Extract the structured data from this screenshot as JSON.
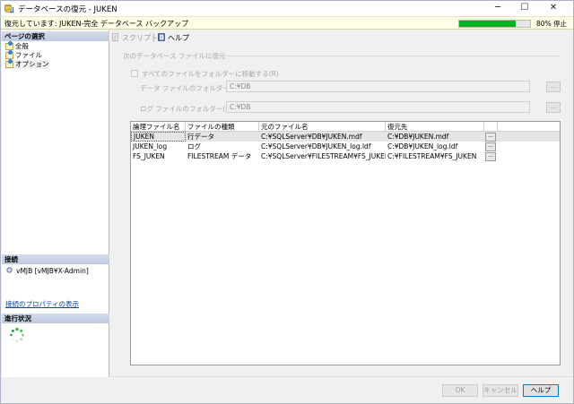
{
  "window": {
    "title": "データベースの復元 - JUKEN",
    "controls": {
      "minimize": "─",
      "maximize": "☐",
      "close": "✕"
    }
  },
  "status": {
    "text": "復元しています: JUKEN-完全 データベース バックアップ",
    "progress_percent": 80,
    "progress_label": "80% 停止",
    "progress_color": "#06b025"
  },
  "sidebar": {
    "page_select_header": "ページの選択",
    "pages": [
      {
        "label": "全般"
      },
      {
        "label": "ファイル"
      },
      {
        "label": "オプション"
      }
    ],
    "connection_header": "接続",
    "connection_user": "vMJB [vMJB¥X-Admin]",
    "connection_link": "接続のプロパティの表示",
    "progress_header": "進行状況"
  },
  "toolbar": {
    "script_label": "スクリプト",
    "script_arrow": "▾",
    "help_label": "ヘルプ"
  },
  "restore_to": {
    "group_title": "次のデータベース ファイルに復元",
    "move_all_label": "すべてのファイルをフォルダーに移動する(R)",
    "data_folder_label": "データ ファイルのフォルダー(D):",
    "data_folder_value": "C:¥DB",
    "log_folder_label": "ログ ファイルのフォルダー(L):",
    "log_folder_value": "C:¥DB",
    "browse_label": "..."
  },
  "file_grid": {
    "columns": [
      "論理ファイル名",
      "ファイルの種類",
      "元のファイル名",
      "復元先"
    ],
    "rows": [
      {
        "logical": "JUKEN",
        "type": "行データ",
        "original": "C:¥SQLServer¥DB¥JUKEN.mdf",
        "restore_as": "C:¥DB¥JUKEN.mdf",
        "btn": "..."
      },
      {
        "logical": "JUKEN_log",
        "type": "ログ",
        "original": "C:¥SQLServer¥DB¥JUKEN_log.ldf",
        "restore_as": "C:¥DB¥JUKEN_log.ldf",
        "btn": "..."
      },
      {
        "logical": "FS_JUKEN",
        "type": "FILESTREAM データ",
        "original": "C:¥SQLServer¥FILESTREAM¥FS_JUKEN",
        "restore_as": "C:¥FILESTREAM¥FS_JUKEN",
        "btn": "..."
      }
    ]
  },
  "buttons": {
    "ok": "OK",
    "cancel": "キャンセル",
    "help": "ヘルプ"
  },
  "colors": {
    "accent": "#0078d7",
    "link": "#0645ad",
    "banner": "#fefee6"
  }
}
